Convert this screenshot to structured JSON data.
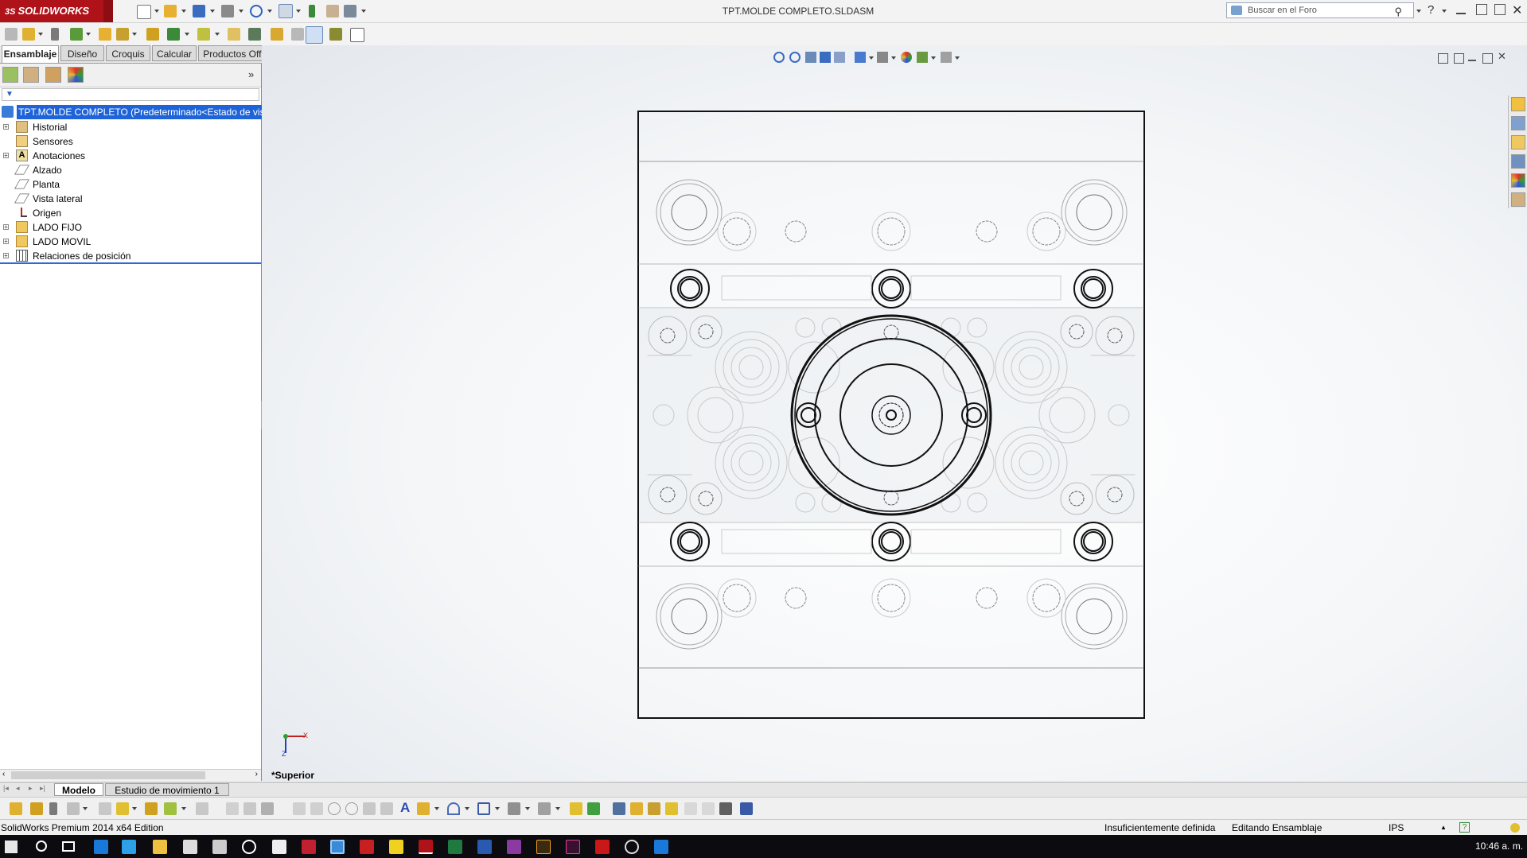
{
  "app": {
    "logo_text": "SOLIDWORKS",
    "document_title": "TPT.MOLDE COMPLETO.SLDASM",
    "search_placeholder": "Buscar en el Foro"
  },
  "command_tabs": [
    {
      "label": "Ensamblaje",
      "active": true
    },
    {
      "label": "Diseño",
      "active": false
    },
    {
      "label": "Croquis",
      "active": false
    },
    {
      "label": "Calcular",
      "active": false
    },
    {
      "label": "Productos Office",
      "active": false
    }
  ],
  "feature_tree": {
    "root": "TPT.MOLDE COMPLETO  (Predeterminado<Estado de visu",
    "items": [
      {
        "label": "Historial",
        "icon": "history-icon",
        "expandable": true
      },
      {
        "label": "Sensores",
        "icon": "sensor-icon",
        "expandable": false
      },
      {
        "label": "Anotaciones",
        "icon": "annotation-icon",
        "expandable": true
      },
      {
        "label": "Alzado",
        "icon": "plane-icon",
        "expandable": false
      },
      {
        "label": "Planta",
        "icon": "plane-icon",
        "expandable": false
      },
      {
        "label": "Vista lateral",
        "icon": "plane-icon",
        "expandable": false
      },
      {
        "label": "Origen",
        "icon": "origin-icon",
        "expandable": false
      },
      {
        "label": "LADO FIJO",
        "icon": "folder-icon",
        "expandable": true
      },
      {
        "label": "LADO MOVIL",
        "icon": "folder-icon",
        "expandable": true
      },
      {
        "label": "Relaciones de posición",
        "icon": "mates-icon",
        "expandable": true
      }
    ]
  },
  "graphics": {
    "view_name": "*Superior",
    "triad_x_label": "X",
    "triad_y_label": "Z"
  },
  "bottom_tabs": [
    {
      "label": "Modelo",
      "active": true
    },
    {
      "label": "Estudio de movimiento 1",
      "active": false
    }
  ],
  "status_bar": {
    "edition": "SolidWorks Premium 2014 x64 Edition",
    "definition_state": "Insuficientemente definida",
    "edit_mode": "Editando Ensamblaje",
    "units": "IPS"
  },
  "taskbar": {
    "clock": "10:46 a. m."
  },
  "colors": {
    "brand_red": "#b0121a",
    "selection_blue": "#1e64d8",
    "taskbar_bg": "#0c0c10"
  }
}
